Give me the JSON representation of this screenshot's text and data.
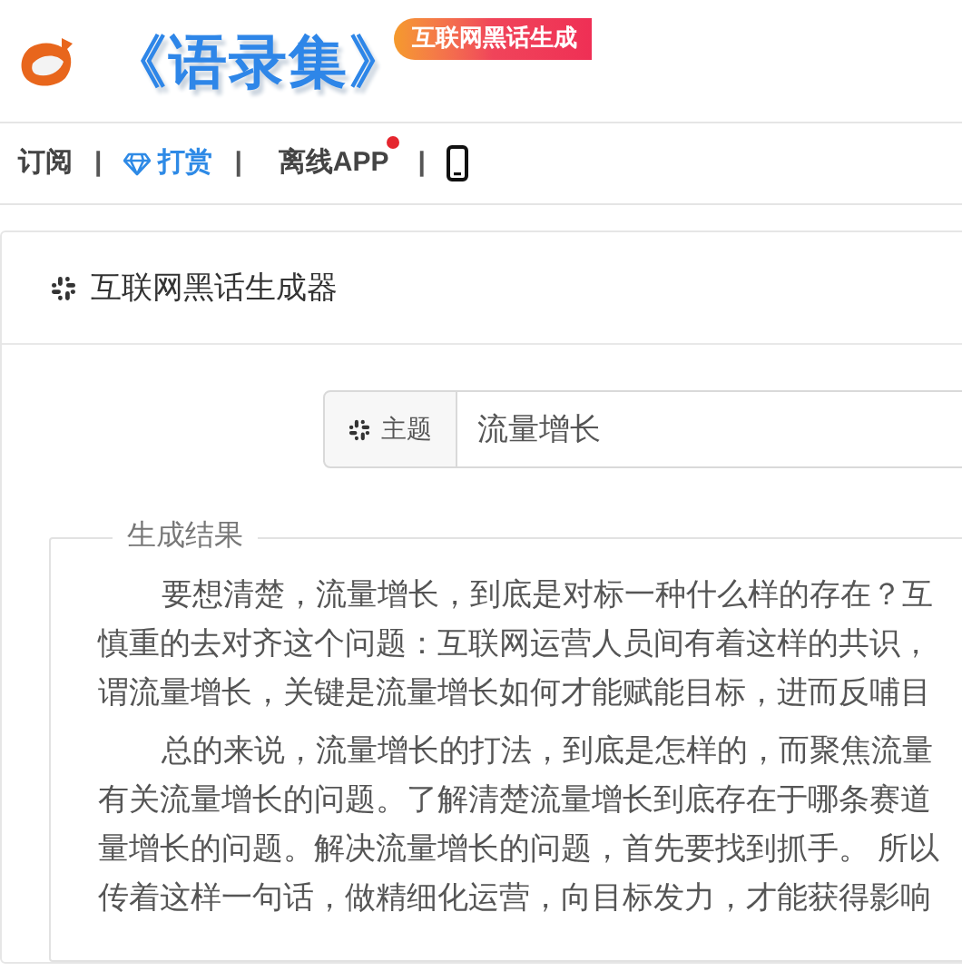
{
  "header": {
    "logo_title": "《语录集》",
    "badge": "互联网黑话生成"
  },
  "nav": [
    {
      "kind": "text",
      "label": "订阅"
    },
    {
      "kind": "separator",
      "label": "|"
    },
    {
      "kind": "gem",
      "label": "打赏"
    },
    {
      "kind": "separator",
      "label": "|"
    },
    {
      "kind": "dot",
      "label": "离线APP"
    },
    {
      "kind": "separator",
      "label": "|"
    },
    {
      "kind": "phone"
    }
  ],
  "card": {
    "title": "互联网黑话生成器"
  },
  "topic": {
    "label": "主题",
    "value": "流量增长"
  },
  "result": {
    "legend": "生成结果",
    "paragraphs": [
      [
        "要想清楚，流量增长，到底是对标一种什么样的存在？互",
        "慎重的去对齐这个问题：互联网运营人员间有着这样的共识，",
        "谓流量增长，关键是流量增长如何才能赋能目标，进而反哺目"
      ],
      [
        "总的来说，流量增长的打法，到底是怎样的，而聚焦流量",
        "有关流量增长的问题。了解清楚流量增长到底存在于哪条赛道",
        "量增长的问题。解决流量增长的问题，首先要找到抓手。 所以",
        "传着这样一句话，做精细化运营，向目标发力，才能获得影响"
      ]
    ]
  }
}
